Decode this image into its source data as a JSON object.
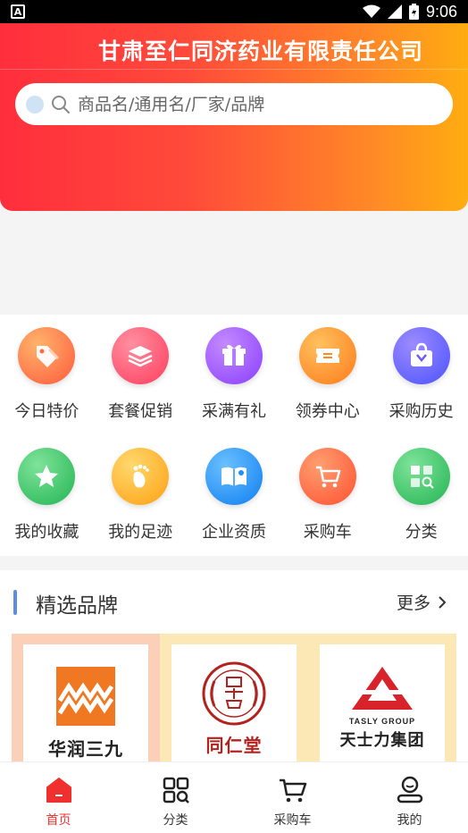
{
  "status_bar": {
    "time": "9:06",
    "notification_icon": "A"
  },
  "header": {
    "company_name": "甘肃至仁同济药业有限责任公司",
    "search_placeholder": "商品名/通用名/厂家/品牌",
    "gradient_start": "#ff2e3c",
    "gradient_end": "#ffad10"
  },
  "quick_menu": {
    "row1": [
      {
        "label": "今日特价",
        "icon": "price-tag-icon",
        "color": "#ff7a45"
      },
      {
        "label": "套餐促销",
        "icon": "layers-icon",
        "color": "#ff4d6a"
      },
      {
        "label": "采满有礼",
        "icon": "gift-icon",
        "color": "#9c4dff"
      },
      {
        "label": "领券中心",
        "icon": "coupon-icon",
        "color": "#ff8a1f"
      },
      {
        "label": "采购历史",
        "icon": "shopping-bag-icon",
        "color": "#6a5bff"
      }
    ],
    "row2": [
      {
        "label": "我的收藏",
        "icon": "star-icon",
        "color": "#3cc76a"
      },
      {
        "label": "我的足迹",
        "icon": "footprint-icon",
        "color": "#ffb21f"
      },
      {
        "label": "企业资质",
        "icon": "certificate-book-icon",
        "color": "#1e8fff"
      },
      {
        "label": "采购车",
        "icon": "cart-icon",
        "color": "#ff6a3d"
      },
      {
        "label": "分类",
        "icon": "category-grid-icon",
        "color": "#3bc46e"
      }
    ]
  },
  "brands": {
    "title": "精选品牌",
    "more_label": "更多",
    "items": [
      {
        "name": "华润三九",
        "logo": "999-logo"
      },
      {
        "name": "同仁堂",
        "logo": "tongrentang-seal-logo"
      },
      {
        "name": "天士力集团",
        "logo": "tasly-logo",
        "logo_text": "TASLY GROUP"
      }
    ]
  },
  "bottom_nav": [
    {
      "label": "首页",
      "icon": "home-icon",
      "active": true
    },
    {
      "label": "分类",
      "icon": "category-icon",
      "active": false
    },
    {
      "label": "采购车",
      "icon": "cart-icon",
      "active": false
    },
    {
      "label": "我的",
      "icon": "profile-icon",
      "active": false
    }
  ]
}
